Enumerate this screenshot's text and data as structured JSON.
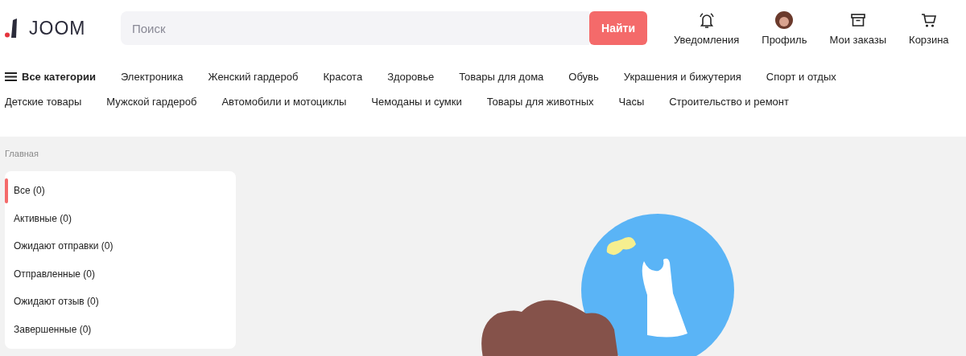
{
  "header": {
    "logo": "JOOM",
    "search": {
      "placeholder": "Поиск"
    },
    "search_button": "Найти",
    "nav": [
      {
        "kind": "bell",
        "label": "Уведомления"
      },
      {
        "kind": "avatar",
        "label": "Профиль"
      },
      {
        "kind": "box",
        "label": "Мои заказы"
      },
      {
        "kind": "cart",
        "label": "Корзина"
      }
    ]
  },
  "categories": {
    "all": "Все категории",
    "items": [
      "Электроника",
      "Женский гардероб",
      "Красота",
      "Здоровье",
      "Товары для дома",
      "Обувь",
      "Украшения и бижутерия",
      "Спорт и отдых",
      "Детские товары",
      "Мужской гардероб",
      "Автомобили и мотоциклы",
      "Чемоданы и сумки",
      "Товары для животных",
      "Часы",
      "Строительство и ремонт"
    ]
  },
  "breadcrumb": "Главная",
  "sidebar": {
    "items": [
      {
        "label": "Все (0)",
        "selected": true
      },
      {
        "label": "Активные (0)",
        "selected": false
      },
      {
        "label": "Ожидают отправки (0)",
        "selected": false
      },
      {
        "label": "Отправленные (0)",
        "selected": false
      },
      {
        "label": "Ожидают отзыв (0)",
        "selected": false
      },
      {
        "label": "Завершенные (0)",
        "selected": false
      }
    ]
  }
}
